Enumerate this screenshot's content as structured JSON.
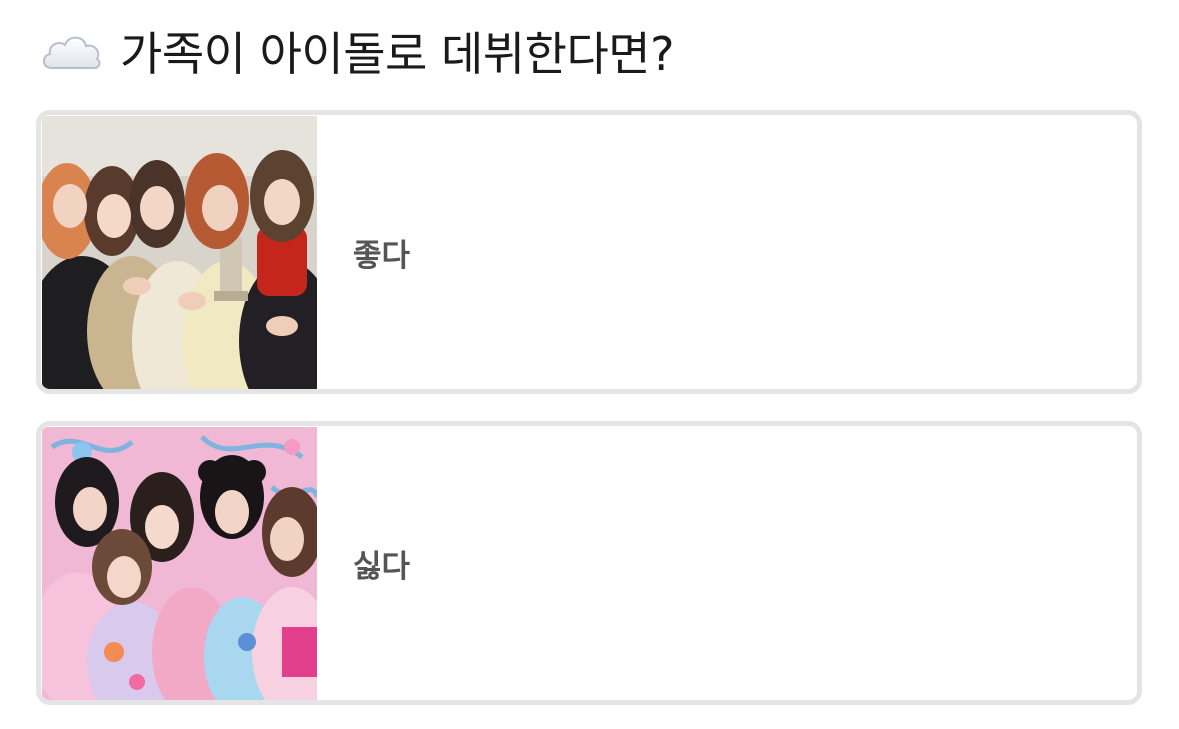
{
  "poll": {
    "icon": "cloud-icon",
    "title": "가족이 아이돌로 데뷔한다면?",
    "options": [
      {
        "label": "좋다",
        "image": "group-photo-with-trophy"
      },
      {
        "label": "싫다",
        "image": "group-photo-pink-background"
      }
    ]
  },
  "colors": {
    "border": "#e4e4e4",
    "label_text": "#555555",
    "title_text": "#1a1a1a"
  }
}
